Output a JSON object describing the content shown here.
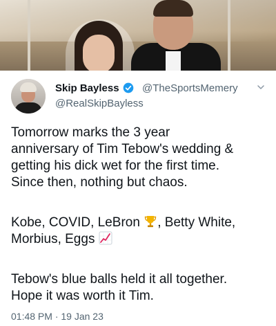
{
  "tweet": {
    "display_name": "Skip Bayless",
    "handle": "@RealSkipBayless",
    "mention": "@TheSportsMemery",
    "paragraph1": [
      "Tomorrow marks the 3 year",
      "anniversary of Tim Tebow's wedding &",
      "getting his dick wet for the first time.",
      "Since then, nothing but chaos."
    ],
    "paragraph2": {
      "line1_before": "Kobe, COVID, LeBron ",
      "line1_after": ", Betty White,",
      "line2": "Morbius, Eggs "
    },
    "paragraph3": [
      "Tebow's blue balls held it all together.",
      "Hope it was worth it Tim."
    ],
    "timestamp": "01:48 PM · 19 Jan 23"
  },
  "icons": {
    "verified": "verified-badge-icon",
    "more": "chevron-down-icon",
    "trophy": "trophy-emoji",
    "chart": "chart-increasing-emoji"
  },
  "colors": {
    "text": "#0f1419",
    "secondary": "#536471",
    "verified": "#1d9bf0"
  }
}
